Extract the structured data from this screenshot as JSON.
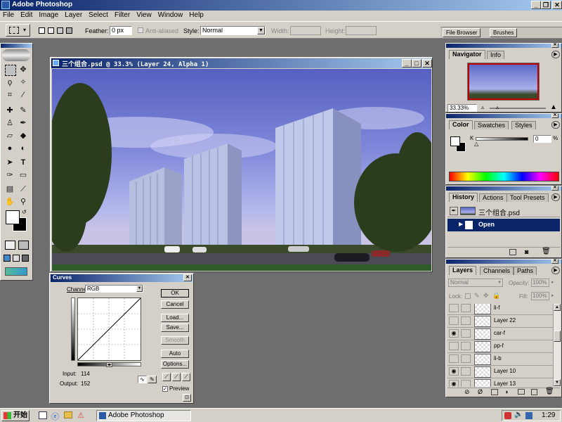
{
  "app": {
    "title": "Adobe Photoshop"
  },
  "menu": [
    "File",
    "Edit",
    "Image",
    "Layer",
    "Select",
    "Filter",
    "View",
    "Window",
    "Help"
  ],
  "options_bar": {
    "feather_label": "Feather:",
    "feather_value": "0 px",
    "anti_aliased_label": "Anti-aliased",
    "style_label": "Style:",
    "style_value": "Normal",
    "width_label": "Width:",
    "height_label": "Height:"
  },
  "palette_well": {
    "file_browser": "File Browser",
    "brushes": "Brushes"
  },
  "document": {
    "title": "三个组合.psd @ 33.3% (Layer 24, Alpha 1)"
  },
  "curves": {
    "title": "Curves",
    "channel_label": "Channel:",
    "channel_value": "RGB",
    "ok": "OK",
    "cancel": "Cancel",
    "load": "Load...",
    "save": "Save...",
    "smooth": "Smooth",
    "auto": "Auto",
    "options": "Options...",
    "input_label": "Input:",
    "input_value": "114",
    "output_label": "Output:",
    "output_value": "152",
    "preview_label": "Preview"
  },
  "navigator": {
    "tabs": [
      "Navigator",
      "Info"
    ],
    "zoom": "33.33%"
  },
  "color": {
    "tabs": [
      "Color",
      "Swatches",
      "Styles"
    ],
    "channel": "K",
    "value": "0",
    "unit": "%"
  },
  "history": {
    "tabs": [
      "History",
      "Actions",
      "Tool Presets"
    ],
    "snapshot": "三个组合.psd",
    "items": [
      "Open"
    ]
  },
  "layers": {
    "tabs": [
      "Layers",
      "Channels",
      "Paths"
    ],
    "blend": "Normal",
    "opacity_label": "Opacity:",
    "opacity_value": "100%",
    "lock_label": "Lock:",
    "fill_label": "Fill:",
    "fill_value": "100%",
    "rows": [
      {
        "name": "li-f",
        "visible": false
      },
      {
        "name": "Layer 22",
        "visible": false
      },
      {
        "name": "car-f",
        "visible": true
      },
      {
        "name": "pp-f",
        "visible": false
      },
      {
        "name": "li-b",
        "visible": false
      },
      {
        "name": "Layer 10",
        "visible": true
      },
      {
        "name": "Layer 13",
        "visible": true
      }
    ]
  },
  "taskbar": {
    "start": "开始",
    "task": "Adobe Photoshop",
    "clock": "1:29"
  }
}
